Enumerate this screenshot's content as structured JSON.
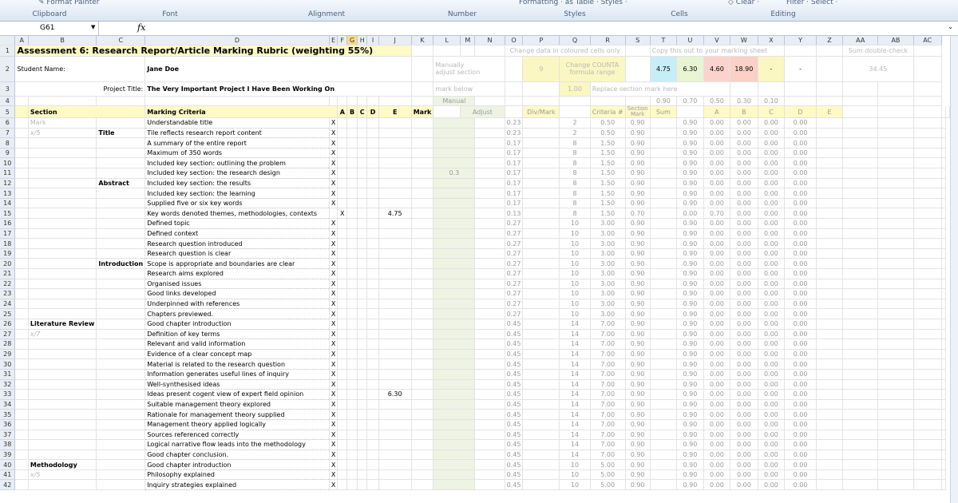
{
  "ribbon": {
    "format_painter": "Format Painter",
    "formatting": "Formatting · as Table · Styles ·",
    "clear": "Clear ·",
    "filter": "Filter ·  Select ·",
    "groups": [
      "Clipboard",
      "Font",
      "Alignment",
      "Number",
      "Styles",
      "Cells",
      "Editing"
    ]
  },
  "namebox": "G61",
  "fx": "fx",
  "columns": [
    "A",
    "B",
    "C",
    "D",
    "E",
    "F",
    "G",
    "H",
    "I",
    "J",
    "K",
    "L",
    "M",
    "N",
    "O",
    "P",
    "Q",
    "R",
    "S",
    "T",
    "U",
    "V",
    "W",
    "X",
    "Y",
    "Z",
    "AA",
    "AB",
    "AC"
  ],
  "header": {
    "title": "Assessment 6:  Research Report/Article Marking Rubric (weighting 55%)",
    "student_label": "Student Name:",
    "student_name": "Jane Doe",
    "project_label": "Project Title:",
    "project_name": "The Very Important Project I Have Been Working On",
    "change_note": "Change data in coloured cells only",
    "copy_note": "Copy this out to your marking sheet",
    "sum_check": "Sum double-check",
    "manually": "Manually",
    "adjust_section": "adjust section",
    "mark_below": "mark below",
    "p2": "9",
    "change_counta": "Change COUNTA",
    "formula_range": "formula range",
    "q3": "1.00",
    "replace_note": "Replace section mark here",
    "marks": [
      "4.75",
      "6.30",
      "4.60",
      "18.90",
      "-",
      "-"
    ],
    "sum_value": "34.45",
    "weights": [
      "0.90",
      "0.70",
      "0.50",
      "0.30",
      "0.10"
    ]
  },
  "table_head": {
    "section": "Section",
    "criteria": "Marking Criteria",
    "a": "A",
    "b": "B",
    "c": "C",
    "d": "D",
    "e": "E",
    "mark": "Mark",
    "manual": "Manual",
    "adjust": "Adjust",
    "divmark": "Div/Mark",
    "critnum": "Criteria #",
    "secmark1": "Section",
    "secmark2": "Mark",
    "sum": "Sum"
  },
  "rows": [
    {
      "n": "6",
      "sec": "Mark",
      "sub": "",
      "crit": "Understandable title",
      "x": "X",
      "xc": "A",
      "div": "0.23",
      "cn": "2",
      "sm": "0.50",
      "s": "0.90",
      "t": [
        "0.90",
        "0.00",
        "0.00",
        "0.00",
        "0.00"
      ]
    },
    {
      "n": "7",
      "sec": "x/5",
      "sub": "Title",
      "crit": "Tile reflects research report content",
      "x": "X",
      "xc": "A",
      "div": "0.23",
      "cn": "2",
      "sm": "0.50",
      "s": "0.90",
      "t": [
        "0.90",
        "0.00",
        "0.00",
        "0.00",
        "0.00"
      ]
    },
    {
      "n": "8",
      "sec": "",
      "sub": "",
      "crit": "A summary of the entire report",
      "x": "X",
      "xc": "A",
      "div": "0.17",
      "cn": "8",
      "sm": "1.50",
      "s": "0.90",
      "t": [
        "0.90",
        "0.00",
        "0.00",
        "0.00",
        "0.00"
      ]
    },
    {
      "n": "9",
      "sec": "",
      "sub": "",
      "crit": "Maximum of 350 words",
      "x": "X",
      "xc": "A",
      "div": "0.17",
      "cn": "8",
      "sm": "1.50",
      "s": "0.90",
      "t": [
        "0.90",
        "0.00",
        "0.00",
        "0.00",
        "0.00"
      ]
    },
    {
      "n": "10",
      "sec": "",
      "sub": "",
      "crit": "Included key section: outlining the problem",
      "x": "X",
      "xc": "A",
      "div": "0.17",
      "cn": "8",
      "sm": "1.50",
      "s": "0.90",
      "t": [
        "0.90",
        "0.00",
        "0.00",
        "0.00",
        "0.00"
      ]
    },
    {
      "n": "11",
      "sec": "",
      "sub": "",
      "crit": "Included key section: the research design",
      "x": "X",
      "xc": "A",
      "div": "0.17",
      "cn": "8",
      "sm": "1.50",
      "s": "0.90",
      "t": [
        "0.90",
        "0.00",
        "0.00",
        "0.00",
        "0.00"
      ]
    },
    {
      "n": "12",
      "sec": "",
      "sub": "Abstract",
      "crit": "Included key section: the results",
      "x": "X",
      "xc": "A",
      "div": "0.17",
      "cn": "8",
      "sm": "1.50",
      "s": "0.90",
      "t": [
        "0.90",
        "0.00",
        "0.00",
        "0.00",
        "0.00"
      ]
    },
    {
      "n": "13",
      "sec": "",
      "sub": "",
      "crit": "Included key section: the learning",
      "x": "X",
      "xc": "A",
      "div": "0.17",
      "cn": "8",
      "sm": "1.50",
      "s": "0.90",
      "t": [
        "0.90",
        "0.00",
        "0.00",
        "0.00",
        "0.00"
      ]
    },
    {
      "n": "14",
      "sec": "",
      "sub": "",
      "crit": "Supplied five or six key words",
      "x": "X",
      "xc": "A",
      "div": "0.17",
      "cn": "8",
      "sm": "1.50",
      "s": "0.90",
      "t": [
        "0.90",
        "0.00",
        "0.00",
        "0.00",
        "0.00"
      ]
    },
    {
      "n": "15",
      "sec": "",
      "sub": "",
      "crit": "Key words denoted themes, methodologies, contexts",
      "x": "X",
      "xc": "B",
      "div": "0.13",
      "cn": "8",
      "sm": "1.50",
      "s": "0.70",
      "t": [
        "0.00",
        "0.70",
        "0.00",
        "0.00",
        "0.00"
      ],
      "mark": "4.75"
    },
    {
      "n": "16",
      "sec": "",
      "sub": "",
      "crit": "Defined topic",
      "x": "X",
      "xc": "A",
      "div": "0.27",
      "cn": "10",
      "sm": "3.00",
      "s": "0.90",
      "t": [
        "0.90",
        "0.00",
        "0.00",
        "0.00",
        "0.00"
      ]
    },
    {
      "n": "17",
      "sec": "",
      "sub": "",
      "crit": "Defined context",
      "x": "X",
      "xc": "A",
      "div": "0.27",
      "cn": "10",
      "sm": "3.00",
      "s": "0.90",
      "t": [
        "0.90",
        "0.00",
        "0.00",
        "0.00",
        "0.00"
      ]
    },
    {
      "n": "18",
      "sec": "",
      "sub": "",
      "crit": "Research question introduced",
      "x": "X",
      "xc": "A",
      "div": "0.27",
      "cn": "10",
      "sm": "3.00",
      "s": "0.90",
      "t": [
        "0.90",
        "0.00",
        "0.00",
        "0.00",
        "0.00"
      ]
    },
    {
      "n": "19",
      "sec": "",
      "sub": "",
      "crit": "Research question is clear",
      "x": "X",
      "xc": "A",
      "div": "0.27",
      "cn": "10",
      "sm": "3.00",
      "s": "0.90",
      "t": [
        "0.90",
        "0.00",
        "0.00",
        "0.00",
        "0.00"
      ]
    },
    {
      "n": "20",
      "sec": "",
      "sub": "Introduction",
      "crit": "Scope is appropriate and boundaries are clear",
      "x": "X",
      "xc": "A",
      "div": "0.27",
      "cn": "10",
      "sm": "3.00",
      "s": "0.90",
      "t": [
        "0.90",
        "0.00",
        "0.00",
        "0.00",
        "0.00"
      ]
    },
    {
      "n": "21",
      "sec": "",
      "sub": "",
      "crit": "Research aims explored",
      "x": "X",
      "xc": "A",
      "div": "0.27",
      "cn": "10",
      "sm": "3.00",
      "s": "0.90",
      "t": [
        "0.90",
        "0.00",
        "0.00",
        "0.00",
        "0.00"
      ]
    },
    {
      "n": "22",
      "sec": "",
      "sub": "",
      "crit": "Organised issues",
      "x": "X",
      "xc": "A",
      "div": "0.27",
      "cn": "10",
      "sm": "3.00",
      "s": "0.90",
      "t": [
        "0.90",
        "0.00",
        "0.00",
        "0.00",
        "0.00"
      ]
    },
    {
      "n": "23",
      "sec": "",
      "sub": "",
      "crit": "Good links developed",
      "x": "X",
      "xc": "A",
      "div": "0.27",
      "cn": "10",
      "sm": "3.00",
      "s": "0.90",
      "t": [
        "0.90",
        "0.00",
        "0.00",
        "0.00",
        "0.00"
      ]
    },
    {
      "n": "24",
      "sec": "",
      "sub": "",
      "crit": "Underpinned with references",
      "x": "X",
      "xc": "A",
      "div": "0.27",
      "cn": "10",
      "sm": "3.00",
      "s": "0.90",
      "t": [
        "0.90",
        "0.00",
        "0.00",
        "0.00",
        "0.00"
      ]
    },
    {
      "n": "25",
      "sec": "",
      "sub": "",
      "crit": "Chapters previewed.",
      "x": "X",
      "xc": "A",
      "div": "0.27",
      "cn": "10",
      "sm": "3.00",
      "s": "0.90",
      "t": [
        "0.90",
        "0.00",
        "0.00",
        "0.00",
        "0.00"
      ]
    },
    {
      "n": "26",
      "sec": "Literature Review",
      "sub": "",
      "crit": "Good chapter introduction",
      "x": "X",
      "xc": "A",
      "div": "0.45",
      "cn": "14",
      "sm": "7.00",
      "s": "0.90",
      "t": [
        "0.90",
        "0.00",
        "0.00",
        "0.00",
        "0.00"
      ]
    },
    {
      "n": "27",
      "sec": "x/7",
      "sub": "",
      "crit": "Definition of key terms",
      "x": "X",
      "xc": "A",
      "div": "0.45",
      "cn": "14",
      "sm": "7.00",
      "s": "0.90",
      "t": [
        "0.90",
        "0.00",
        "0.00",
        "0.00",
        "0.00"
      ]
    },
    {
      "n": "28",
      "sec": "",
      "sub": "",
      "crit": "Relevant and valid information",
      "x": "X",
      "xc": "A",
      "div": "0.45",
      "cn": "14",
      "sm": "7.00",
      "s": "0.90",
      "t": [
        "0.90",
        "0.00",
        "0.00",
        "0.00",
        "0.00"
      ]
    },
    {
      "n": "29",
      "sec": "",
      "sub": "",
      "crit": "Evidence of a clear concept map",
      "x": "X",
      "xc": "A",
      "div": "0.45",
      "cn": "14",
      "sm": "7.00",
      "s": "0.90",
      "t": [
        "0.90",
        "0.00",
        "0.00",
        "0.00",
        "0.00"
      ]
    },
    {
      "n": "30",
      "sec": "",
      "sub": "",
      "crit": "Material is related to the research question",
      "x": "X",
      "xc": "A",
      "div": "0.45",
      "cn": "14",
      "sm": "7.00",
      "s": "0.90",
      "t": [
        "0.90",
        "0.00",
        "0.00",
        "0.00",
        "0.00"
      ]
    },
    {
      "n": "31",
      "sec": "",
      "sub": "",
      "crit": "Information generates useful lines of inquiry",
      "x": "X",
      "xc": "A",
      "div": "0.45",
      "cn": "14",
      "sm": "7.00",
      "s": "0.90",
      "t": [
        "0.90",
        "0.00",
        "0.00",
        "0.00",
        "0.00"
      ]
    },
    {
      "n": "32",
      "sec": "",
      "sub": "",
      "crit": "Well-synthesised ideas",
      "x": "X",
      "xc": "A",
      "div": "0.45",
      "cn": "14",
      "sm": "7.00",
      "s": "0.90",
      "t": [
        "0.90",
        "0.00",
        "0.00",
        "0.00",
        "0.00"
      ]
    },
    {
      "n": "33",
      "sec": "",
      "sub": "",
      "crit": "Ideas present cogent view of expert field opinion",
      "x": "X",
      "xc": "A",
      "div": "0.45",
      "cn": "14",
      "sm": "7.00",
      "s": "0.90",
      "t": [
        "0.90",
        "0.00",
        "0.00",
        "0.00",
        "0.00"
      ],
      "mark": "6.30"
    },
    {
      "n": "34",
      "sec": "",
      "sub": "",
      "crit": "Suitable management theory explored",
      "x": "X",
      "xc": "A",
      "div": "0.45",
      "cn": "14",
      "sm": "7.00",
      "s": "0.90",
      "t": [
        "0.90",
        "0.00",
        "0.00",
        "0.00",
        "0.00"
      ]
    },
    {
      "n": "35",
      "sec": "",
      "sub": "",
      "crit": "Rationale for management theory supplied",
      "x": "X",
      "xc": "A",
      "div": "0.45",
      "cn": "14",
      "sm": "7.00",
      "s": "0.90",
      "t": [
        "0.90",
        "0.00",
        "0.00",
        "0.00",
        "0.00"
      ]
    },
    {
      "n": "36",
      "sec": "",
      "sub": "",
      "crit": "Management theory applied logically",
      "x": "X",
      "xc": "A",
      "div": "0.45",
      "cn": "14",
      "sm": "7.00",
      "s": "0.90",
      "t": [
        "0.90",
        "0.00",
        "0.00",
        "0.00",
        "0.00"
      ]
    },
    {
      "n": "37",
      "sec": "",
      "sub": "",
      "crit": "Sources referenced correctly",
      "x": "X",
      "xc": "A",
      "div": "0.45",
      "cn": "14",
      "sm": "7.00",
      "s": "0.90",
      "t": [
        "0.90",
        "0.00",
        "0.00",
        "0.00",
        "0.00"
      ]
    },
    {
      "n": "38",
      "sec": "",
      "sub": "",
      "crit": "Logical narrative flow leads into the methodology",
      "x": "X",
      "xc": "A",
      "div": "0.45",
      "cn": "14",
      "sm": "7.00",
      "s": "0.90",
      "t": [
        "0.90",
        "0.00",
        "0.00",
        "0.00",
        "0.00"
      ]
    },
    {
      "n": "39",
      "sec": "",
      "sub": "",
      "crit": "Good chapter conclusion.",
      "x": "X",
      "xc": "A",
      "div": "0.45",
      "cn": "14",
      "sm": "7.00",
      "s": "0.90",
      "t": [
        "0.90",
        "0.00",
        "0.00",
        "0.00",
        "0.00"
      ]
    },
    {
      "n": "40",
      "sec": "Methodology",
      "sub": "",
      "crit": "Good chapter introduction",
      "x": "X",
      "xc": "A",
      "div": "0.45",
      "cn": "10",
      "sm": "5.00",
      "s": "0.90",
      "t": [
        "0.90",
        "0.00",
        "0.00",
        "0.00",
        "0.00"
      ]
    },
    {
      "n": "41",
      "sec": "x/5",
      "sub": "",
      "crit": "Philosophy explained",
      "x": "X",
      "xc": "A",
      "div": "0.45",
      "cn": "10",
      "sm": "5.00",
      "s": "0.90",
      "t": [
        "0.90",
        "0.00",
        "0.00",
        "0.00",
        "0.00"
      ]
    },
    {
      "n": "42",
      "sec": "",
      "sub": "",
      "crit": "Inquiry strategies explained",
      "x": "X",
      "xc": "A",
      "div": "0.45",
      "cn": "10",
      "sm": "5.00",
      "s": "0.90",
      "t": [
        "0.90",
        "0.00",
        "0.00",
        "0.00",
        "0.00"
      ]
    }
  ],
  "abstract_adjust": "0.3"
}
